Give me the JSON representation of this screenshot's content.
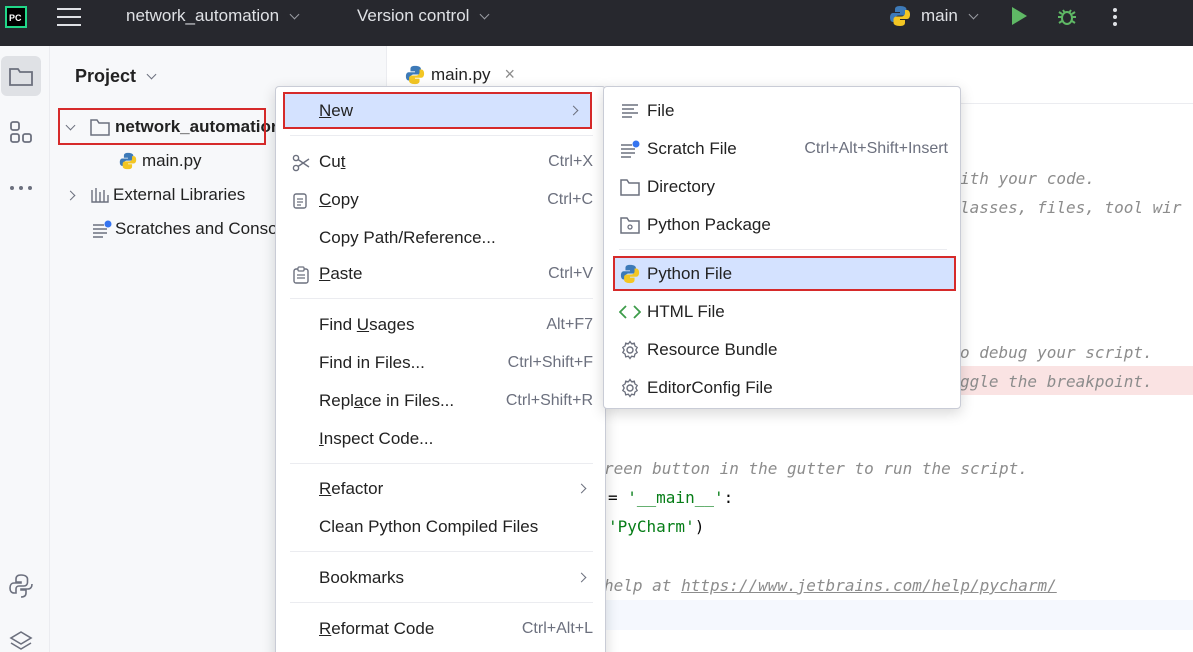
{
  "titlebar": {
    "app_logo_text": "PC",
    "project_name": "network_automation",
    "vcs_label": "Version control",
    "run_config": "main"
  },
  "project_panel": {
    "header": "Project",
    "tree": [
      {
        "label": "network_automation",
        "type": "folder"
      },
      {
        "label": "main.py",
        "type": "python-file"
      },
      {
        "label": "External Libraries",
        "type": "library"
      },
      {
        "label": "Scratches and Consoles",
        "type": "scratches"
      }
    ]
  },
  "editor": {
    "tab_label": "main.py",
    "code_fragments": [
      "ith your code.",
      "lasses, files, tool wir",
      "o debug your script.",
      "ggle the breakpoint.",
      "reen button in the gutter to run the script.",
      "'__main__'",
      "'PyCharm'",
      "help at ",
      "https://www.jetbrains.com/help/pycharm/"
    ]
  },
  "context_menu": {
    "new": {
      "pre": "",
      "mn": "N",
      "post": "ew"
    },
    "cut": {
      "pre": "Cu",
      "mn": "t",
      "post": "",
      "shortcut": "Ctrl+X"
    },
    "copy": {
      "pre": "",
      "mn": "C",
      "post": "opy",
      "shortcut": "Ctrl+C"
    },
    "copy_path": {
      "label": "Copy Path/Reference..."
    },
    "paste": {
      "pre": "",
      "mn": "P",
      "post": "aste",
      "shortcut": "Ctrl+V"
    },
    "find_usages": {
      "pre": "Find ",
      "mn": "U",
      "post": "sages",
      "shortcut": "Alt+F7"
    },
    "find_in_files": {
      "label": "Find in Files...",
      "shortcut": "Ctrl+Shift+F"
    },
    "replace_in_files": {
      "pre": "Repl",
      "mn": "a",
      "post": "ce in Files...",
      "shortcut": "Ctrl+Shift+R"
    },
    "inspect_code": {
      "pre": "",
      "mn": "I",
      "post": "nspect Code..."
    },
    "refactor": {
      "pre": "",
      "mn": "R",
      "post": "efactor"
    },
    "clean_compiled": {
      "label": "Clean Python Compiled Files"
    },
    "bookmarks": {
      "label": "Bookmarks"
    },
    "reformat": {
      "pre": "",
      "mn": "R",
      "post": "eformat Code",
      "shortcut": "Ctrl+Alt+L"
    }
  },
  "new_submenu": {
    "items": [
      {
        "label": "File",
        "shortcut": ""
      },
      {
        "label": "Scratch File",
        "shortcut": "Ctrl+Alt+Shift+Insert"
      },
      {
        "label": "Directory",
        "shortcut": ""
      },
      {
        "label": "Python Package",
        "shortcut": ""
      },
      {
        "label": "Python File",
        "shortcut": ""
      },
      {
        "label": "HTML File",
        "shortcut": ""
      },
      {
        "label": "Resource Bundle",
        "shortcut": ""
      },
      {
        "label": "EditorConfig File",
        "shortcut": ""
      }
    ]
  },
  "colors": {
    "titlebar_bg": "#27282e",
    "selection_bg": "#d4e2ff",
    "highlight_red": "#d62a2a",
    "run_green": "#5fb865",
    "code_string": "#067d17"
  }
}
